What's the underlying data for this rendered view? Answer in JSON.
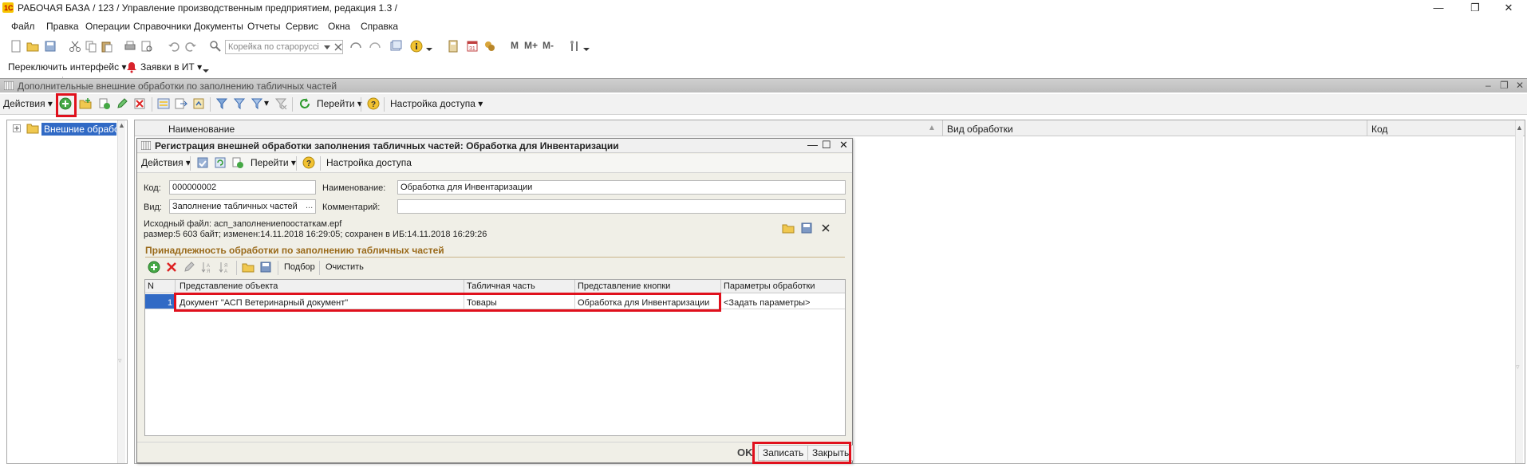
{
  "window": {
    "title": "РАБОЧАЯ БАЗА / 123 /  Управление производственным предприятием, редакция 1.3 /",
    "minimize": "—",
    "maximize": "❐",
    "close": "✕"
  },
  "menu": [
    "Файл",
    "Правка",
    "Операции",
    "Справочники",
    "Документы",
    "Отчеты",
    "Сервис",
    "Окна",
    "Справка"
  ],
  "toolbar": {
    "search_placeholder": "Корейка по староруссі",
    "m": "M",
    "m_plus": "M+",
    "m_minus": "M-"
  },
  "toolbar2": {
    "switch_interface": "Переключить интерфейс",
    "it_requests": "Заявки в ИТ"
  },
  "main_form": {
    "title": "Дополнительные внешние обработки по заполнению табличных частей",
    "actions": "Действия",
    "goto": "Перейти",
    "access": "Настройка доступа",
    "tree_item": "Внешние обработки",
    "columns": [
      "Наименование",
      "Вид обработки",
      "Код"
    ]
  },
  "dialog": {
    "title": "Регистрация внешней обработки заполнения табличных частей: Обработка для Инвентаризации",
    "actions": "Действия",
    "goto": "Перейти",
    "access": "Настройка доступа",
    "code_label": "Код:",
    "code_value": "000000002",
    "name_label": "Наименование:",
    "name_value": "Обработка для Инвентаризации",
    "kind_label": "Вид:",
    "kind_value": "Заполнение табличных частей",
    "comment_label": "Комментарий:",
    "comment_value": "",
    "source_file": "Исходный файл: асп_заполнениепоостаткам.epf",
    "size_info": "размер:5 603 байт; изменен:14.11.2018 16:29:05; сохранен в ИБ:14.11.2018 16:29:26",
    "section_title": "Принадлежность обработки по заполнению табличных частей",
    "pick": "Подбор",
    "clear": "Очистить",
    "table": {
      "columns": [
        "N",
        "Представление объекта",
        "Табличная часть",
        "Представление кнопки",
        "Параметры обработки"
      ],
      "rows": [
        [
          "1",
          "Документ \"АСП Ветеринарный документ\"",
          "Товары",
          "Обработка для Инвентаризации",
          "<Задать параметры>"
        ]
      ]
    },
    "ok": "OK",
    "save": "Записать",
    "close": "Закрыть"
  },
  "colors": {
    "highlight": "#e0101c",
    "selection": "#316ac5",
    "section": "#9a6a1a"
  }
}
